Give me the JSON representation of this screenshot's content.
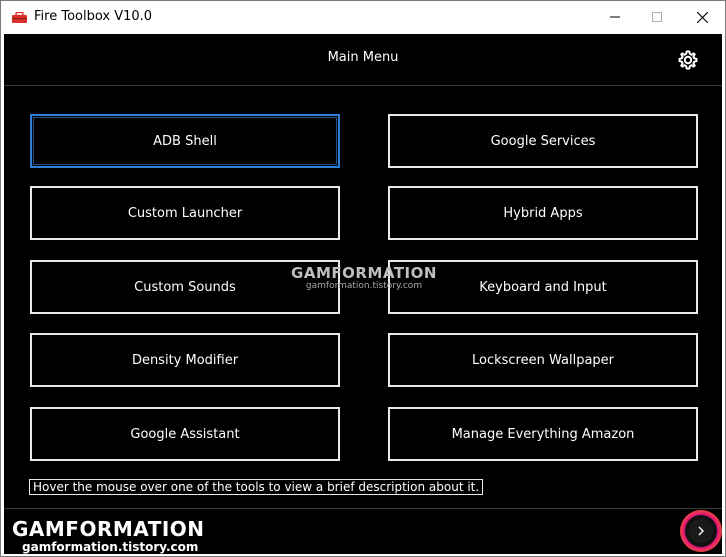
{
  "window": {
    "title": "Fire Toolbox V10.0",
    "icon": "toolbox-icon",
    "controls": {
      "minimize": "minimize-icon",
      "maximize": "maximize-icon",
      "close": "close-icon"
    }
  },
  "header": {
    "title": "Main Menu",
    "settings_icon": "gear-icon"
  },
  "tools": [
    {
      "label": "ADB Shell",
      "focused": true
    },
    {
      "label": "Google Services",
      "focused": false
    },
    {
      "label": "Custom Launcher",
      "focused": false
    },
    {
      "label": "Hybrid Apps",
      "focused": false
    },
    {
      "label": "Custom Sounds",
      "focused": false
    },
    {
      "label": "Keyboard and Input",
      "focused": false
    },
    {
      "label": "Density Modifier",
      "focused": false
    },
    {
      "label": "Lockscreen Wallpaper",
      "focused": false
    },
    {
      "label": "Google Assistant",
      "focused": false
    },
    {
      "label": "Manage Everything Amazon",
      "focused": false
    }
  ],
  "hint": "Hover the mouse over one of the tools to view a brief description about it.",
  "footer": {
    "next_icon": "chevron-right-icon"
  },
  "watermark": {
    "brand": "GAMFORMATION",
    "site": "gamformation.tistory.com"
  },
  "colors": {
    "background": "#000000",
    "button_border": "#e8e8e8",
    "focus_border": "#2f7fd6",
    "text": "#ffffff"
  }
}
